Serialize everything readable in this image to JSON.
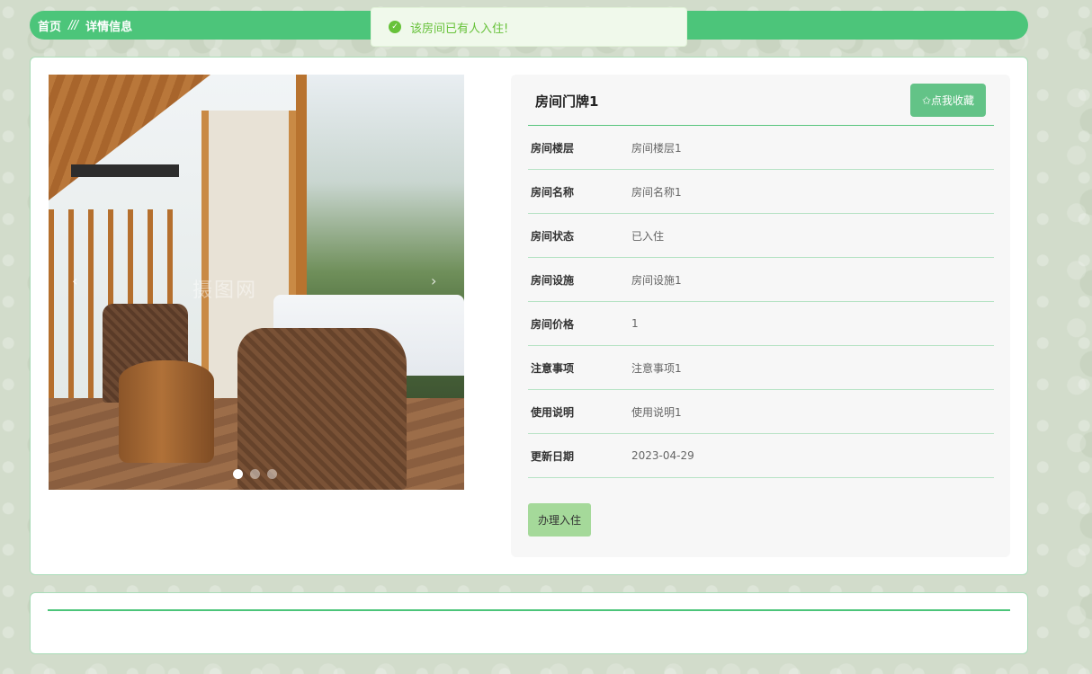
{
  "breadcrumb": {
    "home": "首页",
    "separator": "///",
    "current": "详情信息"
  },
  "toast": {
    "message": "该房间已有人入住!",
    "icon": "success-check-icon",
    "color": "#67c23a"
  },
  "carousel": {
    "watermark": "摄图网",
    "dots": 3,
    "active_index": 0
  },
  "room": {
    "title": "房间门牌1",
    "favorite_label": "✩点我收藏",
    "fields": [
      {
        "label": "房间楼层",
        "value": "房间楼层1"
      },
      {
        "label": "房间名称",
        "value": "房间名称1"
      },
      {
        "label": "房间状态",
        "value": "已入住"
      },
      {
        "label": "房间设施",
        "value": "房间设施1"
      },
      {
        "label": "房间价格",
        "value": "1"
      },
      {
        "label": "注意事项",
        "value": "注意事项1"
      },
      {
        "label": "使用说明",
        "value": "使用说明1"
      },
      {
        "label": "更新日期",
        "value": "2023-04-29"
      }
    ],
    "checkin_label": "办理入住"
  },
  "colors": {
    "accent": "#4cc57a",
    "favorite_button": "#63c387",
    "checkin_button": "#a5d99a"
  }
}
